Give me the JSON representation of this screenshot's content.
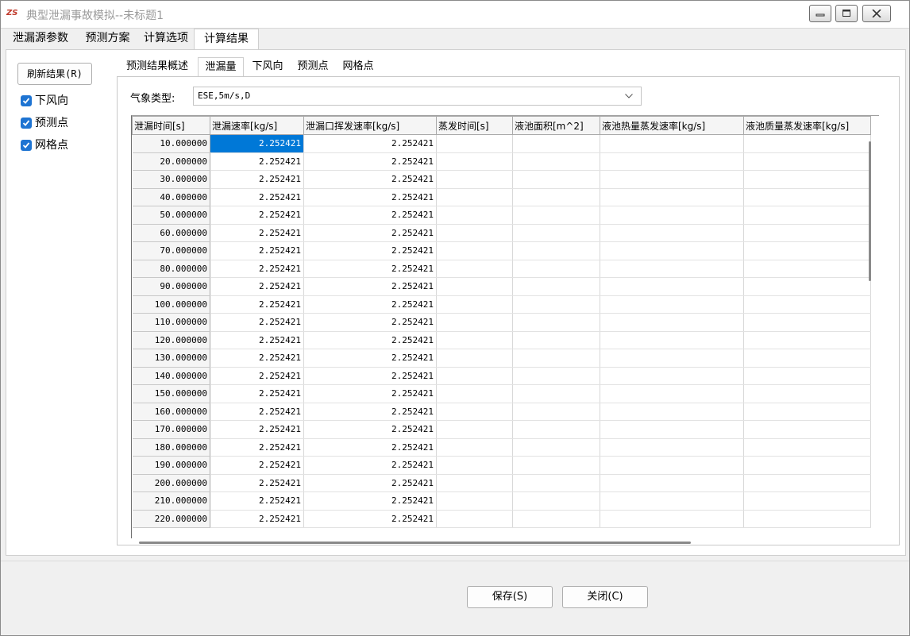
{
  "window": {
    "title": "典型泄漏事故模拟--未标题1",
    "app_icon_text": "ZS"
  },
  "main_tabs": [
    "泄漏源参数",
    "预测方案",
    "计算选项",
    "计算结果"
  ],
  "left_panel": {
    "refresh_label": "刷新结果(R)",
    "checkboxes": [
      {
        "label": "下风向",
        "checked": true
      },
      {
        "label": "预测点",
        "checked": true
      },
      {
        "label": "网格点",
        "checked": true
      }
    ]
  },
  "sub_tabs": [
    "预测结果概述",
    "泄漏量",
    "下风向",
    "预测点",
    "网格点"
  ],
  "meteo": {
    "label": "气象类型:",
    "value": "ESE,5m/s,D"
  },
  "grid": {
    "columns": [
      "泄漏时间[s]",
      "泄漏速率[kg/s]",
      "泄漏口挥发速率[kg/s]",
      "蒸发时间[s]",
      "液池面积[m^2]",
      "液池热量蒸发速率[kg/s]",
      "液池质量蒸发速率[kg/s]"
    ],
    "rows": [
      [
        "10.000000",
        "2.252421",
        "2.252421",
        "",
        "",
        "",
        ""
      ],
      [
        "20.000000",
        "2.252421",
        "2.252421",
        "",
        "",
        "",
        ""
      ],
      [
        "30.000000",
        "2.252421",
        "2.252421",
        "",
        "",
        "",
        ""
      ],
      [
        "40.000000",
        "2.252421",
        "2.252421",
        "",
        "",
        "",
        ""
      ],
      [
        "50.000000",
        "2.252421",
        "2.252421",
        "",
        "",
        "",
        ""
      ],
      [
        "60.000000",
        "2.252421",
        "2.252421",
        "",
        "",
        "",
        ""
      ],
      [
        "70.000000",
        "2.252421",
        "2.252421",
        "",
        "",
        "",
        ""
      ],
      [
        "80.000000",
        "2.252421",
        "2.252421",
        "",
        "",
        "",
        ""
      ],
      [
        "90.000000",
        "2.252421",
        "2.252421",
        "",
        "",
        "",
        ""
      ],
      [
        "100.000000",
        "2.252421",
        "2.252421",
        "",
        "",
        "",
        ""
      ],
      [
        "110.000000",
        "2.252421",
        "2.252421",
        "",
        "",
        "",
        ""
      ],
      [
        "120.000000",
        "2.252421",
        "2.252421",
        "",
        "",
        "",
        ""
      ],
      [
        "130.000000",
        "2.252421",
        "2.252421",
        "",
        "",
        "",
        ""
      ],
      [
        "140.000000",
        "2.252421",
        "2.252421",
        "",
        "",
        "",
        ""
      ],
      [
        "150.000000",
        "2.252421",
        "2.252421",
        "",
        "",
        "",
        ""
      ],
      [
        "160.000000",
        "2.252421",
        "2.252421",
        "",
        "",
        "",
        ""
      ],
      [
        "170.000000",
        "2.252421",
        "2.252421",
        "",
        "",
        "",
        ""
      ],
      [
        "180.000000",
        "2.252421",
        "2.252421",
        "",
        "",
        "",
        ""
      ],
      [
        "190.000000",
        "2.252421",
        "2.252421",
        "",
        "",
        "",
        ""
      ],
      [
        "200.000000",
        "2.252421",
        "2.252421",
        "",
        "",
        "",
        ""
      ],
      [
        "210.000000",
        "2.252421",
        "2.252421",
        "",
        "",
        "",
        ""
      ],
      [
        "220.000000",
        "2.252421",
        "2.252421",
        "",
        "",
        "",
        ""
      ]
    ]
  },
  "footer": {
    "save_label": "保存(S)",
    "close_label": "关闭(C)"
  }
}
